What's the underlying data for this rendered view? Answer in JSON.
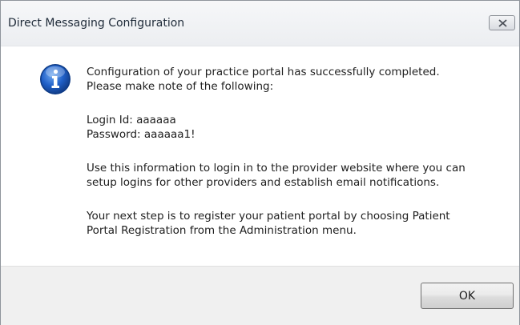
{
  "dialog": {
    "title": "Direct Messaging Configuration",
    "close_icon": "close-icon",
    "info_icon": "information-icon",
    "accent_color": "#1f5fbf",
    "message": {
      "p1": [
        "Configuration of your practice portal has successfully completed.",
        "Please make note of the following:"
      ],
      "p2": [
        "Login Id: aaaaaa",
        "Password: aaaaaa1!"
      ],
      "p3": [
        "Use this information to login in to the provider website where you can",
        "setup logins for other providers and establish email notifications."
      ],
      "p4": [
        "Your next step is to register your patient portal by choosing Patient",
        "Portal Registration from the Administration menu."
      ]
    },
    "ok_label": "OK"
  }
}
